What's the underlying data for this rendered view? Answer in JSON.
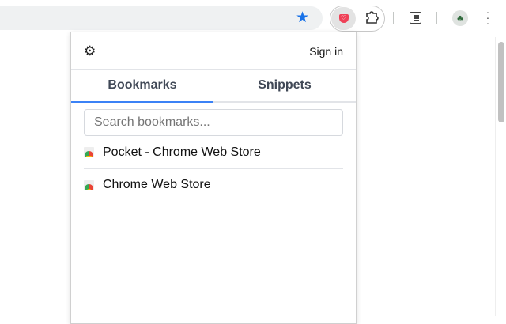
{
  "popup": {
    "sign_in": "Sign in",
    "tabs": [
      {
        "label": "Bookmarks",
        "active": true
      },
      {
        "label": "Snippets",
        "active": false
      }
    ],
    "search_placeholder": "Search bookmarks...",
    "bookmarks": [
      {
        "title": "Pocket - Chrome Web Store",
        "icon": "chrome-web-store-icon"
      },
      {
        "title": "Chrome Web Store",
        "icon": "chrome-web-store-icon"
      }
    ]
  },
  "colors": {
    "accent": "#3b82f6",
    "star": "#1a73e8",
    "pocket": "#ef4056"
  }
}
